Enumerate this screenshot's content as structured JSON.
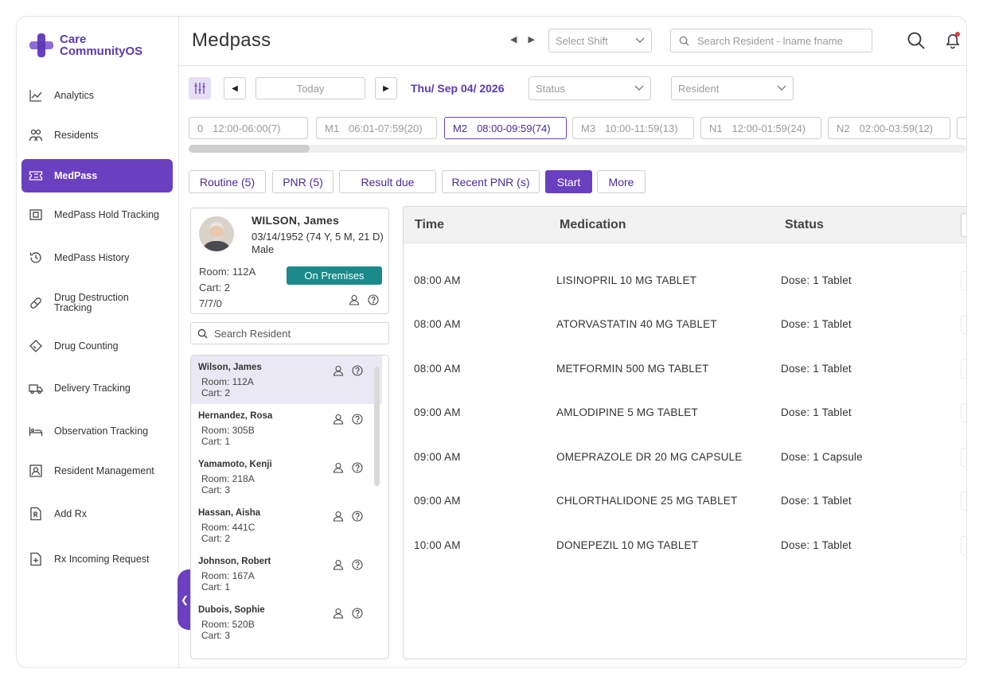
{
  "brand": {
    "line1": "Care",
    "line2": "CommunityOS",
    "accent": "#6a3fc0"
  },
  "sidebar": {
    "items": [
      {
        "label": "Analytics",
        "icon": "chart-line-icon",
        "active": false
      },
      {
        "label": "Residents",
        "icon": "people-icon",
        "active": false
      },
      {
        "label": "MedPass",
        "icon": "ticket-icon",
        "active": true
      },
      {
        "label": "MedPass Hold Tracking",
        "icon": "hold-box-icon",
        "active": false
      },
      {
        "label": "MedPass History",
        "icon": "history-icon",
        "active": false
      },
      {
        "label": "Drug Destruction Tracking",
        "icon": "pill-icon",
        "active": false
      },
      {
        "label": "Drug Counting",
        "icon": "tag-icon",
        "active": false
      },
      {
        "label": "Delivery Tracking",
        "icon": "truck-icon",
        "active": false
      },
      {
        "label": "Observation Tracking",
        "icon": "bed-icon",
        "active": false
      },
      {
        "label": "Resident Management",
        "icon": "person-card-icon",
        "active": false
      },
      {
        "label": "Add Rx",
        "icon": "rx-doc-icon",
        "active": false
      },
      {
        "label": "Rx Incoming Request",
        "icon": "doc-plus-icon",
        "active": false
      }
    ],
    "collapse_glyph": "❮"
  },
  "header": {
    "title": "Medpass",
    "shift_placeholder": "Select Shift",
    "search_placeholder": "Search Resident - lname fname"
  },
  "toolbar": {
    "today_label": "Today",
    "date_label": "Thu/ Sep 04/ 2026",
    "status_placeholder": "Status",
    "resident_placeholder": "Resident"
  },
  "slots": [
    {
      "code": "0",
      "range": "12:00-06:00(7)",
      "active": false
    },
    {
      "code": "M1",
      "range": "06:01-07:59(20)",
      "active": false
    },
    {
      "code": "M2",
      "range": "08:00-09:59(74)",
      "active": true
    },
    {
      "code": "M3",
      "range": "10:00-11:59(13)",
      "active": false
    },
    {
      "code": "N1",
      "range": "12:00-01:59(24)",
      "active": false
    },
    {
      "code": "N2",
      "range": "02:00-03:59(12)",
      "active": false
    }
  ],
  "actions": {
    "routine": "Routine (5)",
    "pnr": "PNR (5)",
    "result_due": "Result due",
    "recent_pnr": "Recent PNR (s)",
    "start": "Start",
    "more": "More"
  },
  "resident_card": {
    "name": "WILSON, James",
    "dob": "03/14/1952 (74 Y, 5 M, 21 D)",
    "sex": "Male",
    "room": "Room: 112A",
    "cart": "Cart: 2",
    "code": "7/7/0",
    "status": "On Premises",
    "status_color": "#1a8a8a"
  },
  "resident_search": {
    "placeholder": "Search Resident"
  },
  "residents": [
    {
      "name": "Wilson, James",
      "room": "Room: 112A",
      "cart": "Cart: 2",
      "selected": true
    },
    {
      "name": "Hernandez, Rosa",
      "room": "Room: 305B",
      "cart": "Cart: 1",
      "selected": false
    },
    {
      "name": "Yamamoto, Kenji",
      "room": "Room: 218A",
      "cart": "Cart: 3",
      "selected": false
    },
    {
      "name": "Hassan, Aisha",
      "room": "Room: 441C",
      "cart": "Cart: 2",
      "selected": false
    },
    {
      "name": "Johnson, Robert",
      "room": "Room: 167A",
      "cart": "Cart: 1",
      "selected": false
    },
    {
      "name": "Dubois, Sophie",
      "room": "Room: 520B",
      "cart": "Cart: 3",
      "selected": false
    }
  ],
  "med_table": {
    "headers": {
      "time": "Time",
      "medication": "Medication",
      "status": "Status"
    },
    "rows": [
      {
        "time": "08:00 AM",
        "medication": "LISINOPRIL 10 MG TABLET",
        "status": "Dose: 1 Tablet"
      },
      {
        "time": "08:00 AM",
        "medication": "ATORVASTATIN 40 MG TABLET",
        "status": "Dose: 1 Tablet"
      },
      {
        "time": "08:00 AM",
        "medication": "METFORMIN 500 MG TABLET",
        "status": "Dose: 1 Tablet"
      },
      {
        "time": "09:00 AM",
        "medication": "AMLODIPINE 5 MG TABLET",
        "status": "Dose: 1 Tablet"
      },
      {
        "time": "09:00 AM",
        "medication": "OMEPRAZOLE DR 20 MG CAPSULE",
        "status": "Dose: 1 Capsule"
      },
      {
        "time": "09:00 AM",
        "medication": "CHLORTHALIDONE 25 MG TABLET",
        "status": "Dose: 1 Tablet"
      },
      {
        "time": "10:00 AM",
        "medication": "DONEPEZIL 10 MG TABLET",
        "status": "Dose: 1 Tablet"
      }
    ]
  }
}
